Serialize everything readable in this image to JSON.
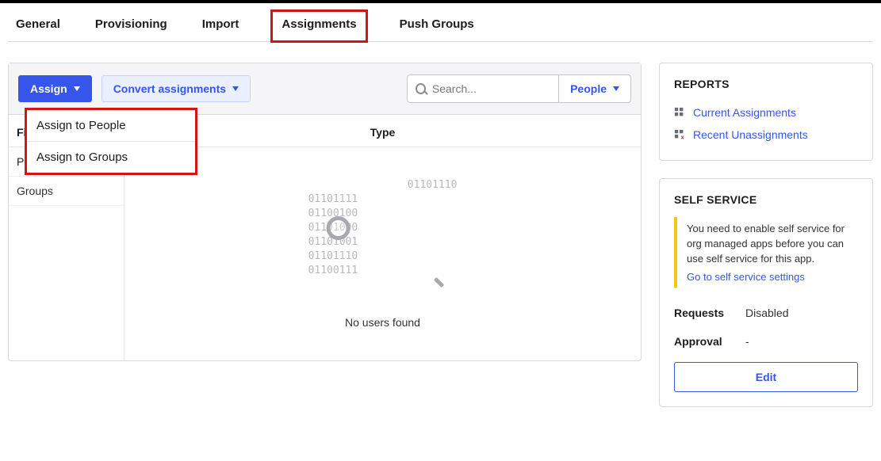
{
  "tabs": {
    "general": "General",
    "provisioning": "Provisioning",
    "import": "Import",
    "assignments": "Assignments",
    "push_groups": "Push Groups"
  },
  "toolbar": {
    "assign_label": "Assign",
    "convert_label": "Convert assignments",
    "search_placeholder": "Search...",
    "scope_label": "People"
  },
  "assign_menu": {
    "people": "Assign to People",
    "groups": "Assign to Groups"
  },
  "filters": {
    "heading": "Fi",
    "people": "Pe",
    "groups": "Groups"
  },
  "content": {
    "type_heading": "Type",
    "empty_msg": "No users found",
    "binary_lines": "01101110\n01101111\n01100100\n01101000\n01101001\n01101110\n01100111"
  },
  "reports": {
    "title": "REPORTS",
    "current": "Current Assignments",
    "recent": "Recent Unassignments"
  },
  "self_service": {
    "title": "SELF SERVICE",
    "notice": "You need to enable self service for org managed apps before you can use self service for this app.",
    "link": "Go to self service settings",
    "requests_k": "Requests",
    "requests_v": "Disabled",
    "approval_k": "Approval",
    "approval_v": "-",
    "edit": "Edit"
  }
}
